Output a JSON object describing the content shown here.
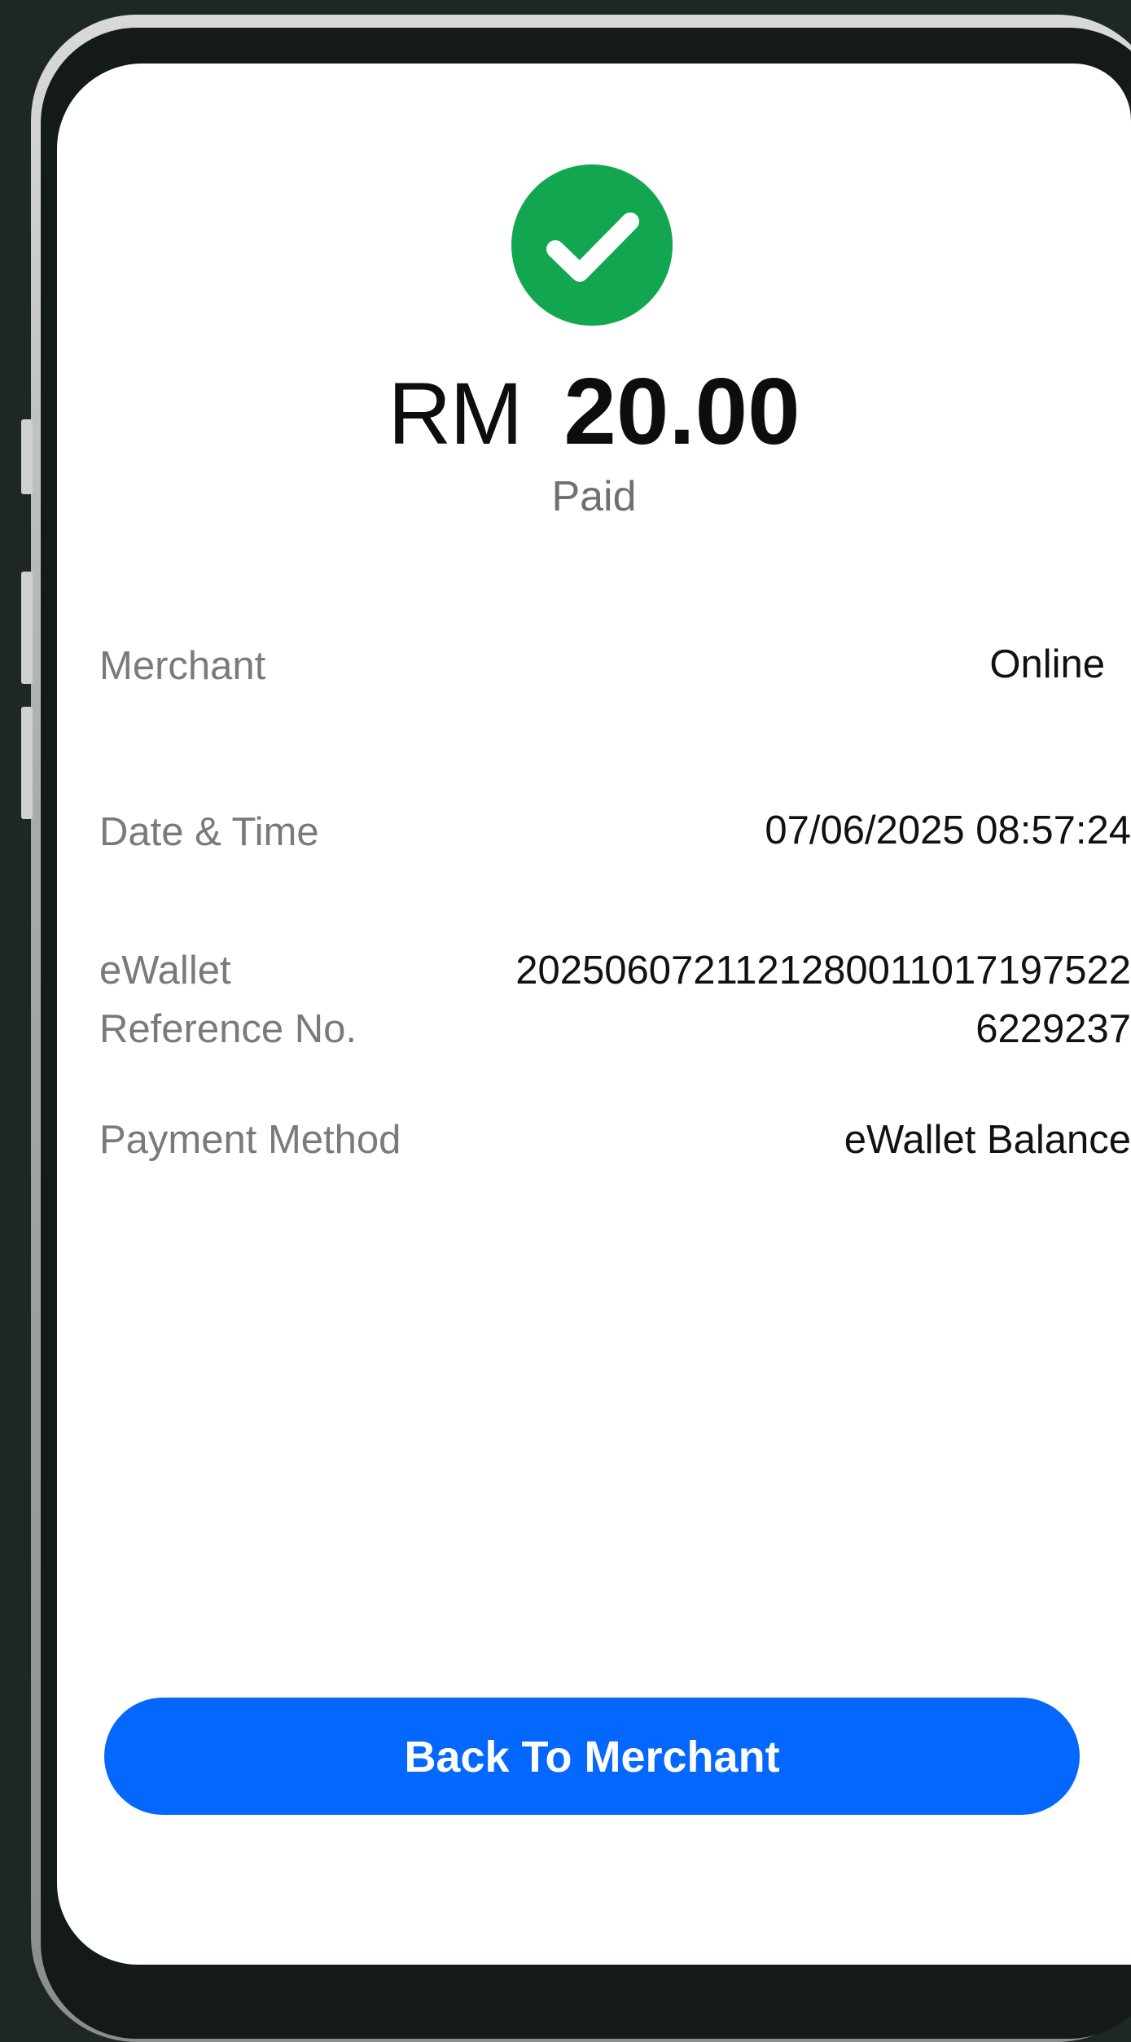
{
  "payment": {
    "currency": "RM",
    "amount": "20.00",
    "status": "Paid"
  },
  "details": {
    "merchant": {
      "label": "Merchant",
      "value": "Online"
    },
    "datetime": {
      "label": "Date & Time",
      "value": "07/06/2025 08:57:24"
    },
    "reference": {
      "label": "eWallet Reference No.",
      "value": "20250607211212800110171975226229237"
    },
    "method": {
      "label": "Payment Method",
      "value": "eWallet Balance"
    }
  },
  "actions": {
    "back_label": "Back To Merchant"
  },
  "colors": {
    "success": "#13a651",
    "primary": "#0468ff",
    "background": "#1f2626"
  },
  "icons": {
    "status": "check-circle-icon"
  }
}
